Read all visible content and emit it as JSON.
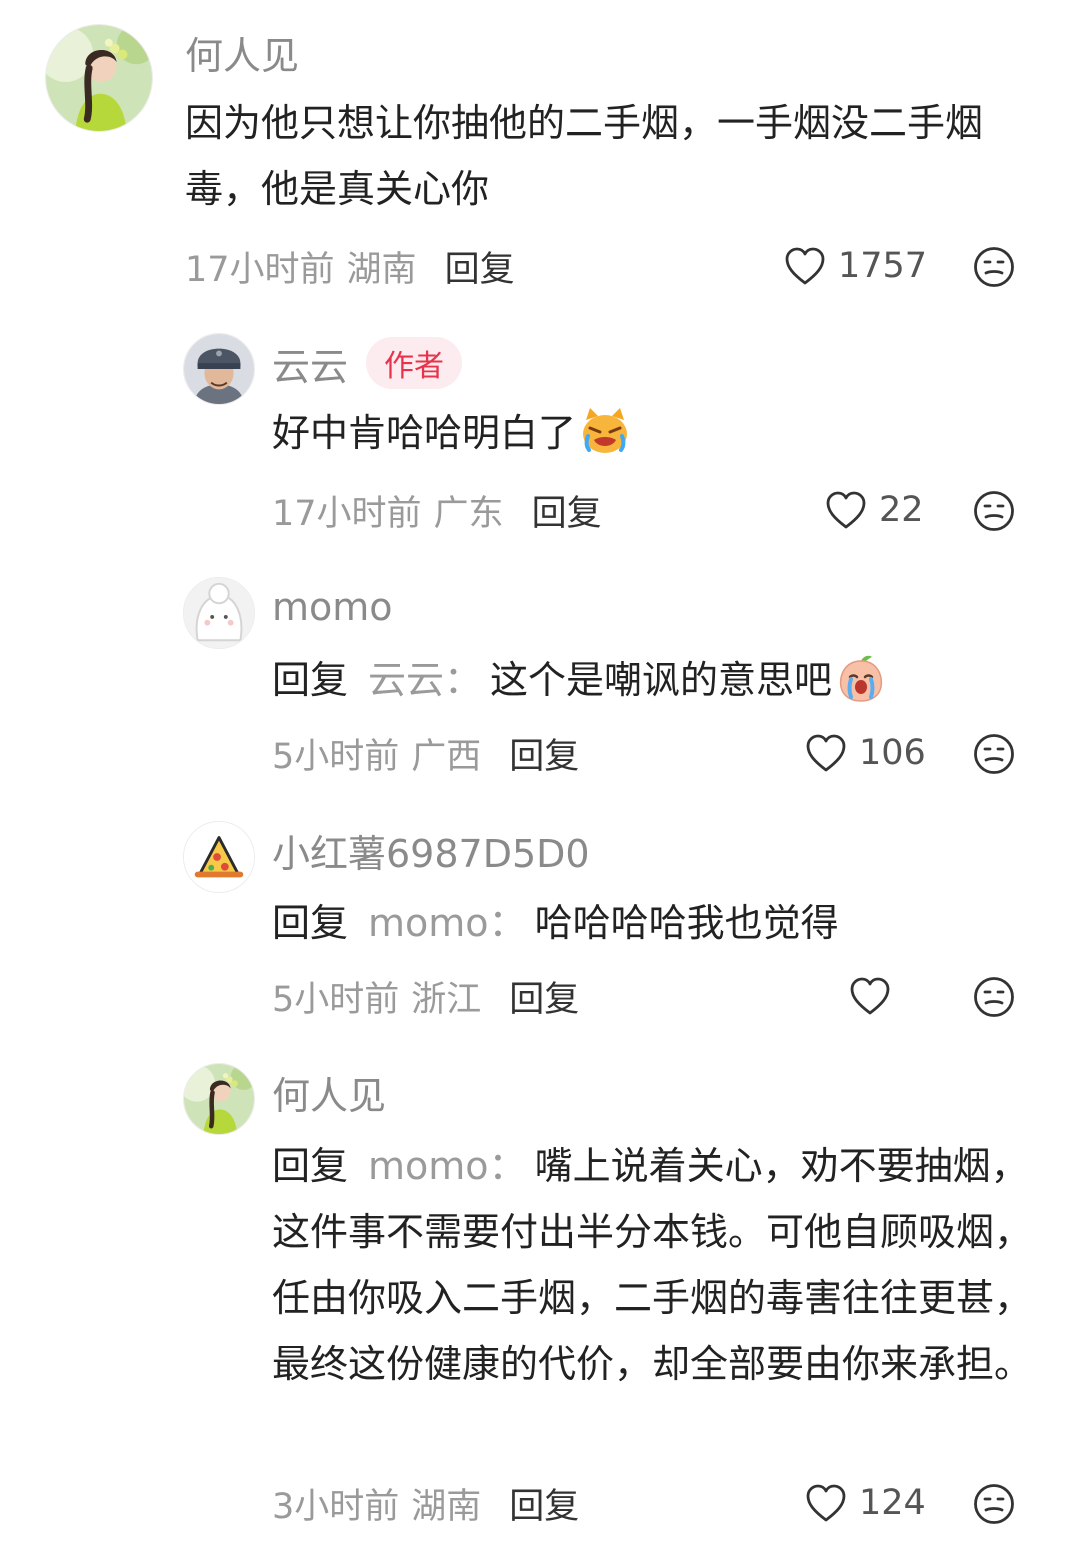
{
  "comments": [
    {
      "username": "何人见",
      "content": "因为他只想让你抽他的二手烟，一手烟没二手烟毒，他是真关心你",
      "time": "17小时前",
      "location": "湖南",
      "reply_label": "回复",
      "likes": "1757",
      "avatar_icon": "girl-photo-avatar"
    },
    {
      "username": "云云",
      "badge": "作者",
      "content": "好中肯哈哈明白了",
      "emoji": "crying-cat-emoji",
      "time": "17小时前",
      "location": "广东",
      "reply_label": "回复",
      "likes": "22",
      "avatar_icon": "man-helmet-avatar"
    },
    {
      "username": "momo",
      "reply_prefix": "回复",
      "reply_to": "云云",
      "separator": "：",
      "content": "这个是嘲讽的意思吧",
      "emoji": "crying-peach-emoji",
      "time": "5小时前",
      "location": "广西",
      "reply_label": "回复",
      "likes": "106",
      "avatar_icon": "white-cat-avatar"
    },
    {
      "username": "小红薯6987D5D0",
      "reply_prefix": "回复",
      "reply_to": "momo",
      "separator": "：",
      "content": "哈哈哈哈我也觉得",
      "time": "5小时前",
      "location": "浙江",
      "reply_label": "回复",
      "likes": "",
      "avatar_icon": "pizza-avatar"
    },
    {
      "username": "何人见",
      "reply_prefix": "回复",
      "reply_to": "momo",
      "separator": "：",
      "content": "嘴上说着关心，劝不要抽烟，这件事不需要付出半分本钱。可他自顾吸烟，任由你吸入二手烟，二手烟的毒害往往更甚，最终这份健康的代价，却全部要由你来承担。",
      "time": "3小时前",
      "location": "湖南",
      "reply_label": "回复",
      "likes": "124",
      "avatar_icon": "girl-photo-avatar"
    }
  ],
  "colors": {
    "meta_text": "#9a9a9a",
    "badge_bg": "#fdecef",
    "badge_text": "#e8334d"
  }
}
